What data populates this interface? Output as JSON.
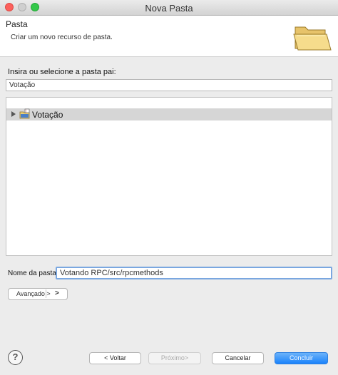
{
  "window": {
    "title": "Nova Pasta"
  },
  "header": {
    "title": "Pasta",
    "description": "Criar um novo recurso de pasta.",
    "icon": "folder-icon"
  },
  "parent_folder": {
    "prompt": "Insira ou selecione a pasta pai:",
    "input_value": "Votação"
  },
  "tree": {
    "items": [
      {
        "label": "Votação",
        "icon": "java-project-icon",
        "expanded": false,
        "selected": true
      }
    ]
  },
  "folder_name": {
    "label": "Nome da pasta:",
    "value": "Votando RPC/src/rpcmethods"
  },
  "advanced": {
    "label": "Avançado >",
    "arrow": ">"
  },
  "buttons": {
    "help": "?",
    "back": "< Voltar",
    "next": "Próximo>",
    "cancel": "Cancelar",
    "finish": "Concluir"
  },
  "colors": {
    "accent": "#1a82fb",
    "selection": "#d6d6d6",
    "focus_border": "#7aa7e0"
  }
}
